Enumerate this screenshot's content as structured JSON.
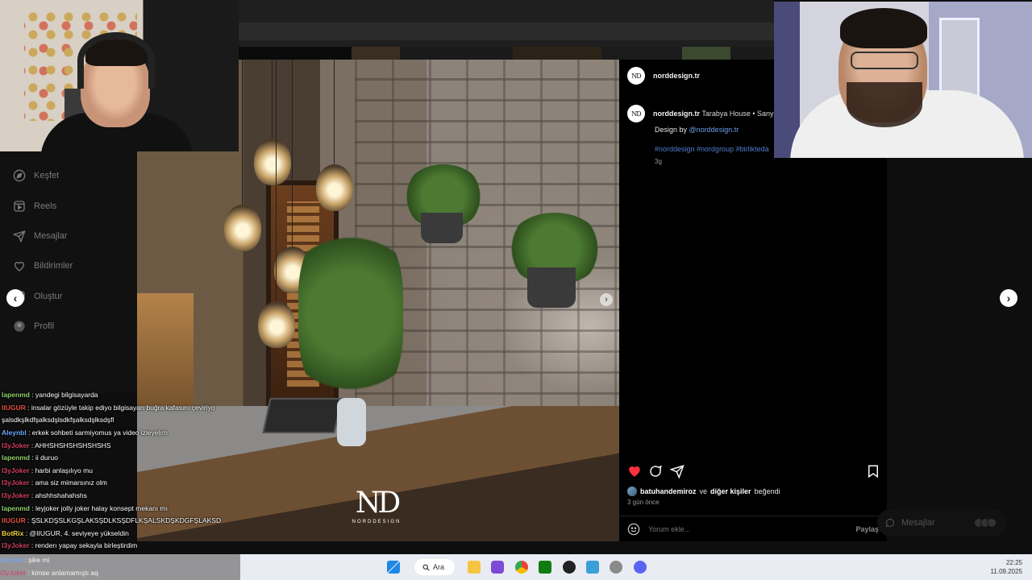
{
  "sidebar": {
    "items": [
      {
        "label": "Keşfet",
        "icon": "compass-icon"
      },
      {
        "label": "Reels",
        "icon": "reels-icon"
      },
      {
        "label": "Mesajlar",
        "icon": "send-icon"
      },
      {
        "label": "Bildirimler",
        "icon": "heart-icon"
      },
      {
        "label": "Oluştur",
        "icon": "plus-icon"
      },
      {
        "label": "Profil",
        "icon": "profile-icon"
      }
    ]
  },
  "post": {
    "username": "norddesign.tr",
    "avatar_text": "ND",
    "caption_location": "Tarabya House • Sany",
    "design_prefix": "Design by ",
    "design_mention": "@norddesign.tr",
    "hashtags": "#norddesign #nordgroup #birlikteda",
    "caption_age": "3g",
    "likes_user": "batuhandemiroz",
    "likes_mid": " ve ",
    "likes_others": "diğer kişiler",
    "likes_suffix": " beğendi",
    "date": "3 gün önce",
    "comment_placeholder": "Yorum ekle...",
    "share_label": "Paylaş",
    "watermark_big": "ND",
    "watermark_small": "NORDDESIGN",
    "accent_like": "#ff3040",
    "link_color": "#4e7ed0"
  },
  "messages_pill": {
    "label": "Mesajlar"
  },
  "chat": [
    {
      "user": "lapenmd",
      "text": " : yandegi bilgisayarda",
      "color": "#8fd16b"
    },
    {
      "user": "IIUGUR",
      "text": " : insalar gözüyle takip ediyo bilgisayarı buğra kafasını çeviriyo",
      "color": "#e0503a"
    },
    {
      "user": "",
      "text": "şalsdkşlkdfşalksdşlsdkfşalksdşlksdşfl",
      "color": "#ffffff"
    },
    {
      "user": "Aleynbl",
      "text": " : erkek sohbeti sarmiyomus ya video izleyelım",
      "color": "#6fa8ff"
    },
    {
      "user": "I3yJoker",
      "text": " : AHHSHSHSHSHSHSHS",
      "color": "#d04060"
    },
    {
      "user": "lapenmd",
      "text": " : ii duruo",
      "color": "#8fd16b"
    },
    {
      "user": "I3yJoker",
      "text": " : harbi anlaşılıyo mu",
      "color": "#d04060"
    },
    {
      "user": "I3yJoker",
      "text": " : ama siz mimarsınız olm",
      "color": "#d04060"
    },
    {
      "user": "I3yJoker",
      "text": " : ahshhshahahshs",
      "color": "#d04060"
    },
    {
      "user": "lapenmd",
      "text": " : leyjoker jolly joker halay konsept mekanı mı",
      "color": "#8fd16b"
    },
    {
      "user": "IIUGUR",
      "text": " : ŞSLKDŞSLKGŞLAKSŞDLKSŞDFLKŞALSKDŞKDGFŞLAKSD",
      "color": "#e0503a"
    },
    {
      "user": "BotRix",
      "text": " : @IIUGUR, 4. seviyeye yükseldin",
      "color": "#f0d040"
    },
    {
      "user": "I3yJoker",
      "text": " : renderı yapay sekayla birleştirdim",
      "color": "#d04060"
    },
    {
      "user": "Aleynbl",
      "text": " : şike mi",
      "color": "#6fa8ff"
    },
    {
      "user": "I3yJoker",
      "text": " : kimse anlamamıştı aq",
      "color": "#d04060"
    }
  ],
  "taskbar": {
    "search_label": "Ara",
    "time": "22:25",
    "date": "11.09.2025"
  }
}
